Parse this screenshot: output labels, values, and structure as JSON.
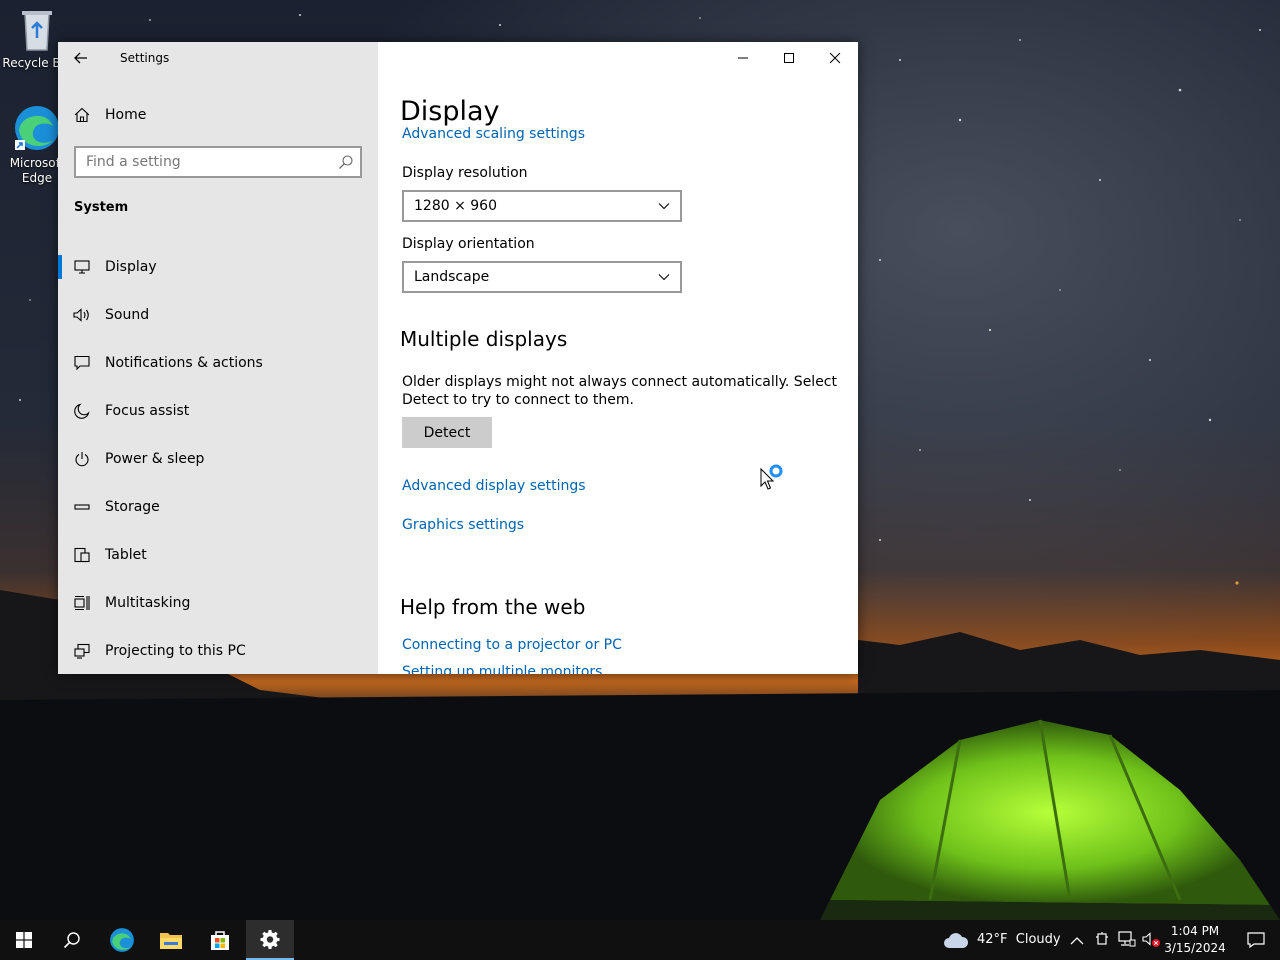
{
  "desktop": {
    "icons": [
      {
        "label": "Recycle Bin"
      },
      {
        "label": "Microsoft Edge"
      }
    ]
  },
  "window": {
    "app_title": "Settings",
    "sidebar": {
      "home_label": "Home",
      "search_placeholder": "Find a setting",
      "section_title": "System",
      "items": [
        {
          "label": "Display",
          "icon": "monitor-icon",
          "selected": true
        },
        {
          "label": "Sound",
          "icon": "speaker-icon"
        },
        {
          "label": "Notifications & actions",
          "icon": "notification-icon"
        },
        {
          "label": "Focus assist",
          "icon": "moon-icon"
        },
        {
          "label": "Power & sleep",
          "icon": "power-icon"
        },
        {
          "label": "Storage",
          "icon": "storage-icon"
        },
        {
          "label": "Tablet",
          "icon": "tablet-icon"
        },
        {
          "label": "Multitasking",
          "icon": "multitasking-icon"
        },
        {
          "label": "Projecting to this PC",
          "icon": "projecting-icon"
        }
      ]
    },
    "content": {
      "page_title": "Display",
      "cut_off_link": "Advanced scaling settings",
      "resolution_label": "Display resolution",
      "resolution_value": "1280 × 960",
      "orientation_label": "Display orientation",
      "orientation_value": "Landscape",
      "multiple_displays_heading": "Multiple displays",
      "multiple_displays_text": "Older displays might not always connect automatically. Select Detect to try to connect to them.",
      "detect_label": "Detect",
      "advanced_display_link": "Advanced display settings",
      "graphics_link": "Graphics settings",
      "help_heading": "Help from the web",
      "help_links": [
        "Connecting to a projector or PC",
        "Setting up multiple monitors"
      ]
    }
  },
  "taskbar": {
    "weather": "42°F  Cloudy",
    "time": "1:04 PM",
    "date": "3/15/2024"
  },
  "colors": {
    "accent": "#0078d7",
    "link": "#0063b1",
    "sidebar_bg": "#e6e6e6",
    "taskbar_bg": "#101010"
  }
}
